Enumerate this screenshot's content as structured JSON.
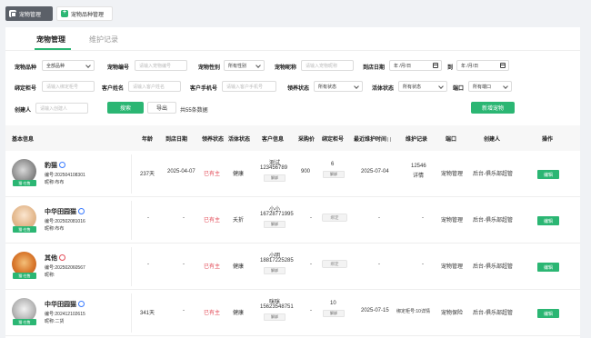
{
  "topbar": {
    "tab1": "宠物管理",
    "tab2": "宠物品种管理"
  },
  "tabs": {
    "active": "宠物管理",
    "other": "维护记录"
  },
  "filters": {
    "breed_label": "宠物品种",
    "breed_value": "全部品种",
    "code_label": "宠物编号",
    "code_placeholder": "请输入宠物编号",
    "gender_label": "宠物性别",
    "gender_value": "所有性别",
    "nick_label": "宠物昵称",
    "nick_placeholder": "请输入宠物昵称",
    "date_label": "到店日期",
    "date_placeholder": "年 /月/日",
    "to": "到",
    "date_placeholder2": "年 /月/日",
    "cabinet_label": "绑定柜号",
    "cabinet_placeholder": "请输入绑定柜号",
    "customer_label": "客户姓名",
    "customer_placeholder": "请输入客户姓名",
    "phone_label": "客户手机号",
    "phone_placeholder": "请输入客户手机号",
    "feed_label": "领养状态",
    "feed_value": "所有状态",
    "live_label": "活体状态",
    "live_value": "所有状态",
    "port_label": "端口",
    "port_value": "所有端口",
    "creator_label": "创建人",
    "creator_placeholder": "请输入创建人",
    "search_btn": "搜索",
    "export_btn": "导出",
    "count": "共55条数据",
    "new_btn": "新增宠物"
  },
  "table": {
    "headers": [
      "基本信息",
      "年龄",
      "到店日期",
      "领养状态",
      "活体状态",
      "客户信息",
      "采购价",
      "绑定柜号",
      "最近维护时间",
      "维护记录",
      "端口",
      "创建人",
      "操作"
    ],
    "rows": [
      {
        "name": "豹猫",
        "code": "编号:202504108301",
        "nick": "昵称:布布",
        "cat_tag": "猫·在售",
        "age": "237天",
        "date": "2025-04-07",
        "status": "已有主",
        "live": "健康",
        "cust_name": "测试",
        "cust_phone": "123456789",
        "unbind": "解绑",
        "price": "900",
        "cabinet": "6",
        "cab_action": "解绑",
        "maint": "2025-07-04",
        "rec1": "12546",
        "rec2": "详情",
        "port": "宠物管理",
        "creator": "后台-俱乐部超管",
        "op": "编辑"
      },
      {
        "name": "中华田园猫",
        "code": "编号:202502081016",
        "nick": "昵称:布布",
        "cat_tag": "猫·在售",
        "age": "-",
        "date": "-",
        "status": "已有主",
        "live": "夭折",
        "cust_name": "小小",
        "cust_phone": "16728771995",
        "unbind": "解绑",
        "price": "-",
        "cabinet": "",
        "cab_action": "绑定",
        "maint": "-",
        "rec1": "-",
        "rec2": "",
        "port": "宠物管理",
        "creator": "后台-俱乐部超管",
        "op": "编辑"
      },
      {
        "name": "其他",
        "code": "编号:202502060567",
        "nick": "昵称:",
        "cat_tag": "猫·在售",
        "age": "-",
        "date": "-",
        "status": "已有主",
        "live": "健康",
        "cust_name": "小明",
        "cust_phone": "18817225285",
        "unbind": "解绑",
        "price": "-",
        "cabinet": "",
        "cab_action": "绑定",
        "maint": "-",
        "rec1": "-",
        "rec2": "",
        "port": "宠物管理",
        "creator": "后台-俱乐部超管",
        "op": "编辑"
      },
      {
        "name": "中华田园猫",
        "code": "编号:202412102615",
        "nick": "昵称:二货",
        "cat_tag": "猫·在售",
        "age": "341天",
        "date": "-",
        "status": "已有主",
        "live": "健康",
        "cust_name": "咪咪",
        "cust_phone": "15623548751",
        "unbind": "解绑",
        "price": "-",
        "cabinet": "10",
        "cab_action": "解绑",
        "maint": "2025-07-15",
        "rec1": "绑定柜号:10详情",
        "rec2": "",
        "port": "宠物保险",
        "creator": "后台-俱乐部超管",
        "op": "编辑"
      }
    ]
  }
}
